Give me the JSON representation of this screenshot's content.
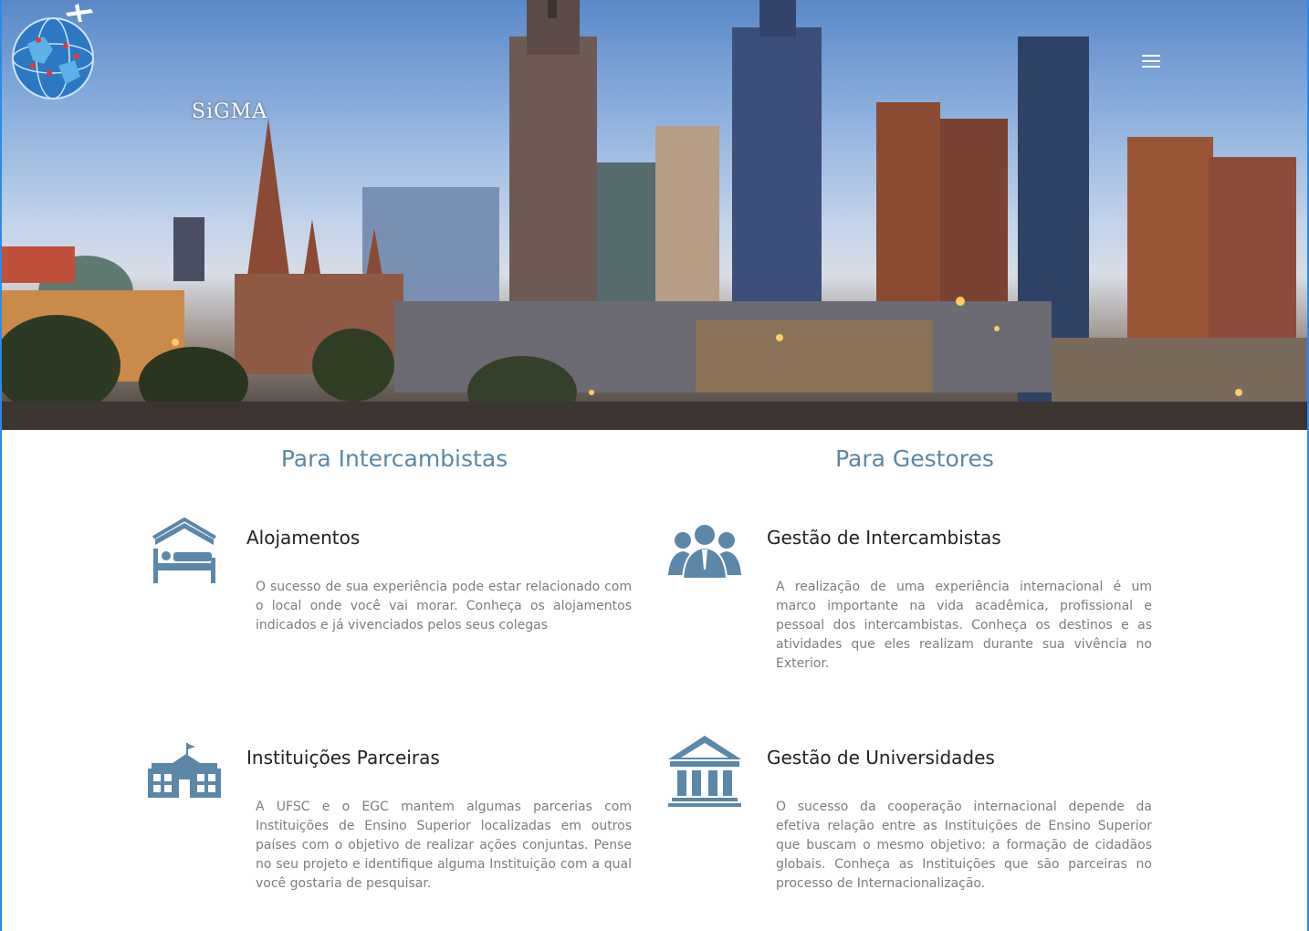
{
  "brand": {
    "logo_text": "SiGMA"
  },
  "nav": {
    "menu_icon": "hamburger-menu-icon"
  },
  "colors": {
    "accent": "#5b87a8",
    "heading": "#222222",
    "body_text": "#7d7d7d"
  },
  "sections": {
    "intercambistas": {
      "title": "Para Intercambistas"
    },
    "gestores": {
      "title": "Para Gestores"
    }
  },
  "features": {
    "alojamentos": {
      "icon": "bed-house-icon",
      "title": "Alojamentos",
      "text": "O sucesso de sua experiência pode estar relacionado com o local onde você vai morar. Conheça os alojamentos indicados e já vivenciados pelos seus colegas"
    },
    "gestao_intercambistas": {
      "icon": "people-group-icon",
      "title": "Gestão de Intercambistas",
      "text": "A realização de uma experiência internacional é um marco importante na vida acadêmica, profissional e pessoal dos intercambistas. Conheça os destinos e as atividades que eles realizam durante sua vivência no Exterior."
    },
    "instituicoes_parceiras": {
      "icon": "school-building-icon",
      "title": "Instituições Parceiras",
      "text": "A UFSC e o EGC mantem algumas parcerias com Instituições de Ensino Superior localizadas em outros países com o objetivo de realizar ações conjuntas. Pense no seu projeto e identifique alguma Instituição com a qual você gostaria de pesquisar."
    },
    "gestao_universidades": {
      "icon": "university-columns-icon",
      "title": "Gestão de Universidades",
      "text": "O sucesso da cooperação internacional depende da efetiva relação entre as Instituições de Ensino Superior que buscam o mesmo objetivo: a formação de cidadãos globais. Conheça as Instituições que são parceiras no processo de Internacionalização."
    }
  }
}
